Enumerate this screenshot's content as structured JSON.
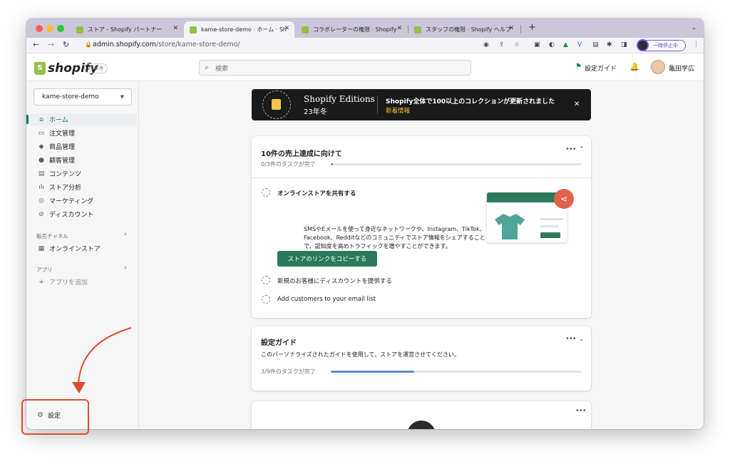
{
  "browser": {
    "tabs": [
      {
        "label": "ストア - Shopify パートナー"
      },
      {
        "label": "kame-store-demo · ホーム · Sh"
      },
      {
        "label": "コラボレーターの権限 · Shopify"
      },
      {
        "label": "スタッフの権限 · Shopify ヘルプ"
      }
    ],
    "url_host": "admin.shopify.com",
    "url_path": "/store/kame-store-demo/",
    "pause_label": "一時停止中"
  },
  "header": {
    "logo": "shopify",
    "edition_badge": "23年冬",
    "search_placeholder": "検索",
    "setup_guide": "設定ガイド",
    "user_name": "亀田学広"
  },
  "sidebar": {
    "store_name": "kame-store-demo",
    "items": [
      {
        "label": "ホーム",
        "icon": "home-icon"
      },
      {
        "label": "注文管理",
        "icon": "inbox-icon"
      },
      {
        "label": "商品管理",
        "icon": "tag-icon"
      },
      {
        "label": "顧客管理",
        "icon": "person-icon"
      },
      {
        "label": "コンテンツ",
        "icon": "content-icon"
      },
      {
        "label": "ストア分析",
        "icon": "analytics-icon"
      },
      {
        "label": "マーケティング",
        "icon": "target-icon"
      },
      {
        "label": "ディスカウント",
        "icon": "discount-icon"
      }
    ],
    "sales_channels_label": "販売チャネル",
    "online_store": "オンラインストア",
    "apps_label": "アプリ",
    "add_app": "アプリを追加",
    "settings": "設定"
  },
  "banner": {
    "title": "Shopify Editions",
    "subtitle": "23年冬",
    "message": "Shopify全体で100以上のコレクションが更新されました",
    "link": "新着情報"
  },
  "card_sales": {
    "title": "10件の売上達成に向けて",
    "progress_text": "0/3件のタスクが完了",
    "progress_fraction": 0.0,
    "task1_title": "オンラインストアを共有する",
    "task1_desc": "SMSやEメールを使って身近なネットワークや、Instagram、TikTok、Facebook、Redditなどのコミュニティでストア情報をシェアすることで、認知度を高めトラフィックを増やすことができます。",
    "task1_button": "ストアのリンクをコピーする",
    "task2": "新規のお客様にディスカウントを提供する",
    "task3": "Add customers to your email list"
  },
  "card_guide": {
    "title": "設定ガイド",
    "desc": "このパーソナライズされたガイドを使用して、ストアを運営させてください。",
    "progress_text": "3/9件のタスクが完了",
    "progress_fraction": 0.333
  },
  "colors": {
    "accent_green": "#008060",
    "annotation_red": "#e04b2c",
    "progress_blue": "#5b8ec2"
  }
}
